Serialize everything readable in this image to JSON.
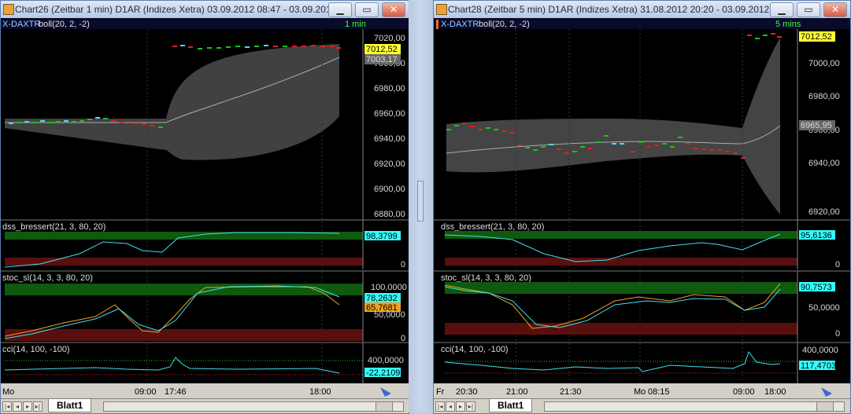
{
  "left": {
    "title": "Chart26 (Zeitbar 1 min)  D1AR (Indizes Xetra) 03.09.2012 08:47 - 03.09.2012 1...",
    "symbol_label": "X-DAXTR",
    "indicator": "boll(20, 2, -2)",
    "timeframe": "1 min",
    "yticks": [
      "7020,00",
      "7000,00",
      "6980,00",
      "6960,00",
      "6940,00",
      "6920,00",
      "6900,00",
      "6880,00"
    ],
    "price_badge": "7012,52",
    "boll_badge": "7003,17",
    "dss_label": "dss_bressert(21, 3, 80, 20)",
    "dss_value": "98,3799",
    "dss_zero": "0",
    "stoc_label": "stoc_sl(14, 3, 3, 80, 20)",
    "stoc_top": "100,0000",
    "stoc_mid": "50,0000",
    "stoc_zero": "0",
    "stoc_v1": "78,2632",
    "stoc_v2": "65,7681",
    "cci_label": "cci(14, 100, -100)",
    "cci_top": "400,0000",
    "cci_value": "-22,2109",
    "xlabels": [
      "Mo",
      "09:00",
      "17:46",
      "18:00"
    ],
    "sheet_tab": "Blatt1"
  },
  "right": {
    "title": "Chart28 (Zeitbar 5 min)  D1AR (Indizes Xetra) 31.08.2012 20:20 - 03.09.2012 ...",
    "symbol_label": "X-DAXTR",
    "indicator": "boll(20, 2, -2)",
    "timeframe": "5 mins",
    "yticks": [
      "7000,00",
      "6980,00",
      "6960,00",
      "6940,00",
      "6920,00"
    ],
    "price_badge": "7012,52",
    "boll_badge": "6965,95",
    "dss_label": "dss_bressert(21, 3, 80, 20)",
    "dss_value": "95,6136",
    "dss_zero": "0",
    "stoc_label": "stoc_sl(14, 3, 3, 80, 20)",
    "stoc_value": "90,7573",
    "stoc_mid": "50,0000",
    "stoc_zero": "0",
    "cci_label": "cci(14, 100, -100)",
    "cci_top": "400,0000",
    "cci_value": "117,4703",
    "xlabels": [
      "Fr",
      "20:30",
      "21:00",
      "21:30",
      "Mo",
      "08:15",
      "09:00",
      "18:00"
    ],
    "sheet_tab": "Blatt1"
  },
  "window_buttons": {
    "minimize": "▁",
    "maximize": "▭",
    "close": "✕"
  },
  "colors": {
    "up": "#1fc21f",
    "down": "#e02020",
    "neutral": "#40e0f0",
    "band": "#4a4a4a",
    "panel_bg": "#000000",
    "green_zone": "#0f5a0f",
    "red_zone": "#5a0f0f",
    "badge_yellow": "#ffff33",
    "badge_cyan": "#33ffff"
  }
}
